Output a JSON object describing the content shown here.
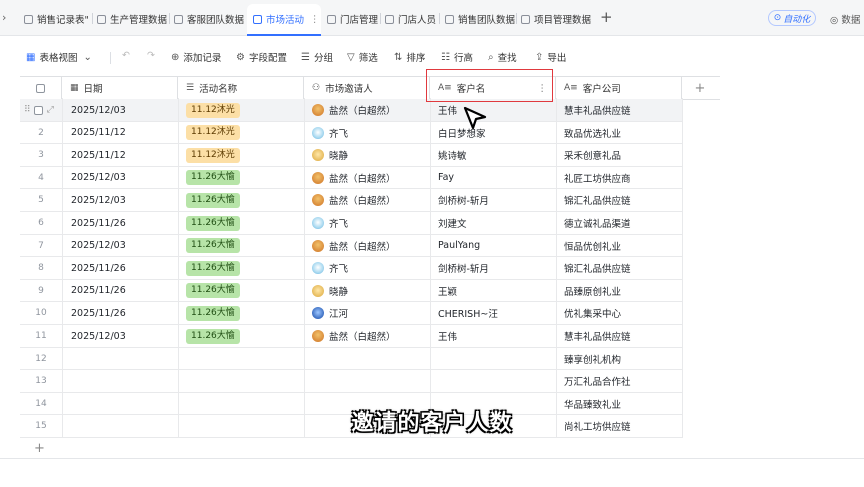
{
  "tabs": [
    {
      "label": "销售记录表\""
    },
    {
      "label": "生产管理数据"
    },
    {
      "label": "客服团队数据"
    },
    {
      "label": "市场活动"
    },
    {
      "label": "门店管理"
    },
    {
      "label": "门店人员"
    },
    {
      "label": "销售团队数据"
    },
    {
      "label": "项目管理数据"
    }
  ],
  "active_tab": "市场活动",
  "header_right": {
    "automation": "自动化",
    "data_label": "数据"
  },
  "toolbar": {
    "view": "表格视图",
    "add_record": "添加记录",
    "field_config": "字段配置",
    "group": "分组",
    "filter": "筛选",
    "sort": "排序",
    "row_height": "行高",
    "search": "查找",
    "export": "导出"
  },
  "columns": [
    "日期",
    "活动名称",
    "市场邀请人",
    "客户名",
    "客户公司"
  ],
  "rows": [
    {
      "num": "1",
      "date": "2025/12/03",
      "activity": "11.12沐光",
      "inviter": "盐然（白超然）",
      "customer": "王伟",
      "company": "慧丰礼品供应链"
    },
    {
      "num": "2",
      "date": "2025/11/12",
      "activity": "11.12沐光",
      "inviter": "齐飞",
      "customer": "白日梦想家",
      "company": "致品优选礼业"
    },
    {
      "num": "3",
      "date": "2025/11/12",
      "activity": "11.12沐光",
      "inviter": "晓静",
      "customer": "姚诗敏",
      "company": "采禾创意礼品"
    },
    {
      "num": "4",
      "date": "2025/12/03",
      "activity": "11.26大愉",
      "inviter": "盐然（白超然）",
      "customer": "Fay",
      "company": "礼匠工坊供应商"
    },
    {
      "num": "5",
      "date": "2025/12/03",
      "activity": "11.26大愉",
      "inviter": "盐然（白超然）",
      "customer": "剑桥树-斩月",
      "company": "锦汇礼品供应链"
    },
    {
      "num": "6",
      "date": "2025/11/26",
      "activity": "11.26大愉",
      "inviter": "齐飞",
      "customer": "刘建文",
      "company": "德立诚礼品渠道"
    },
    {
      "num": "7",
      "date": "2025/12/03",
      "activity": "11.26大愉",
      "inviter": "盐然（白超然）",
      "customer": "PaulYang",
      "company": "恒品优创礼业"
    },
    {
      "num": "8",
      "date": "2025/11/26",
      "activity": "11.26大愉",
      "inviter": "齐飞",
      "customer": "剑桥树-斩月",
      "company": "锦汇礼品供应链"
    },
    {
      "num": "9",
      "date": "2025/11/26",
      "activity": "11.26大愉",
      "inviter": "晓静",
      "customer": "王颖",
      "company": "品臻原创礼业"
    },
    {
      "num": "10",
      "date": "2025/11/26",
      "activity": "11.26大愉",
      "inviter": "江河",
      "customer": "CHERISH~汪",
      "company": "优礼集采中心"
    },
    {
      "num": "11",
      "date": "2025/12/03",
      "activity": "11.26大愉",
      "inviter": "盐然（白超然）",
      "customer": "王伟",
      "company": "慧丰礼品供应链"
    },
    {
      "num": "12",
      "date": "",
      "activity": "",
      "inviter": "",
      "customer": "",
      "company": "臻享创礼机构"
    },
    {
      "num": "13",
      "date": "",
      "activity": "",
      "inviter": "",
      "customer": "",
      "company": "万汇礼品合作社"
    },
    {
      "num": "14",
      "date": "",
      "activity": "",
      "inviter": "",
      "customer": "",
      "company": "华品臻致礼业"
    },
    {
      "num": "15",
      "date": "",
      "activity": "",
      "inviter": "",
      "customer": "",
      "company": "尚礼工坊供应链"
    }
  ],
  "subtitle": "邀请的客户人数",
  "colors": {
    "accent": "#3370ff",
    "highlight": "#e0393e",
    "tag_1112": "#fcdfa6",
    "tag_1126": "#b7e4a8"
  },
  "icons": {
    "add_column": "plus-icon",
    "add_row": "plus-icon"
  }
}
